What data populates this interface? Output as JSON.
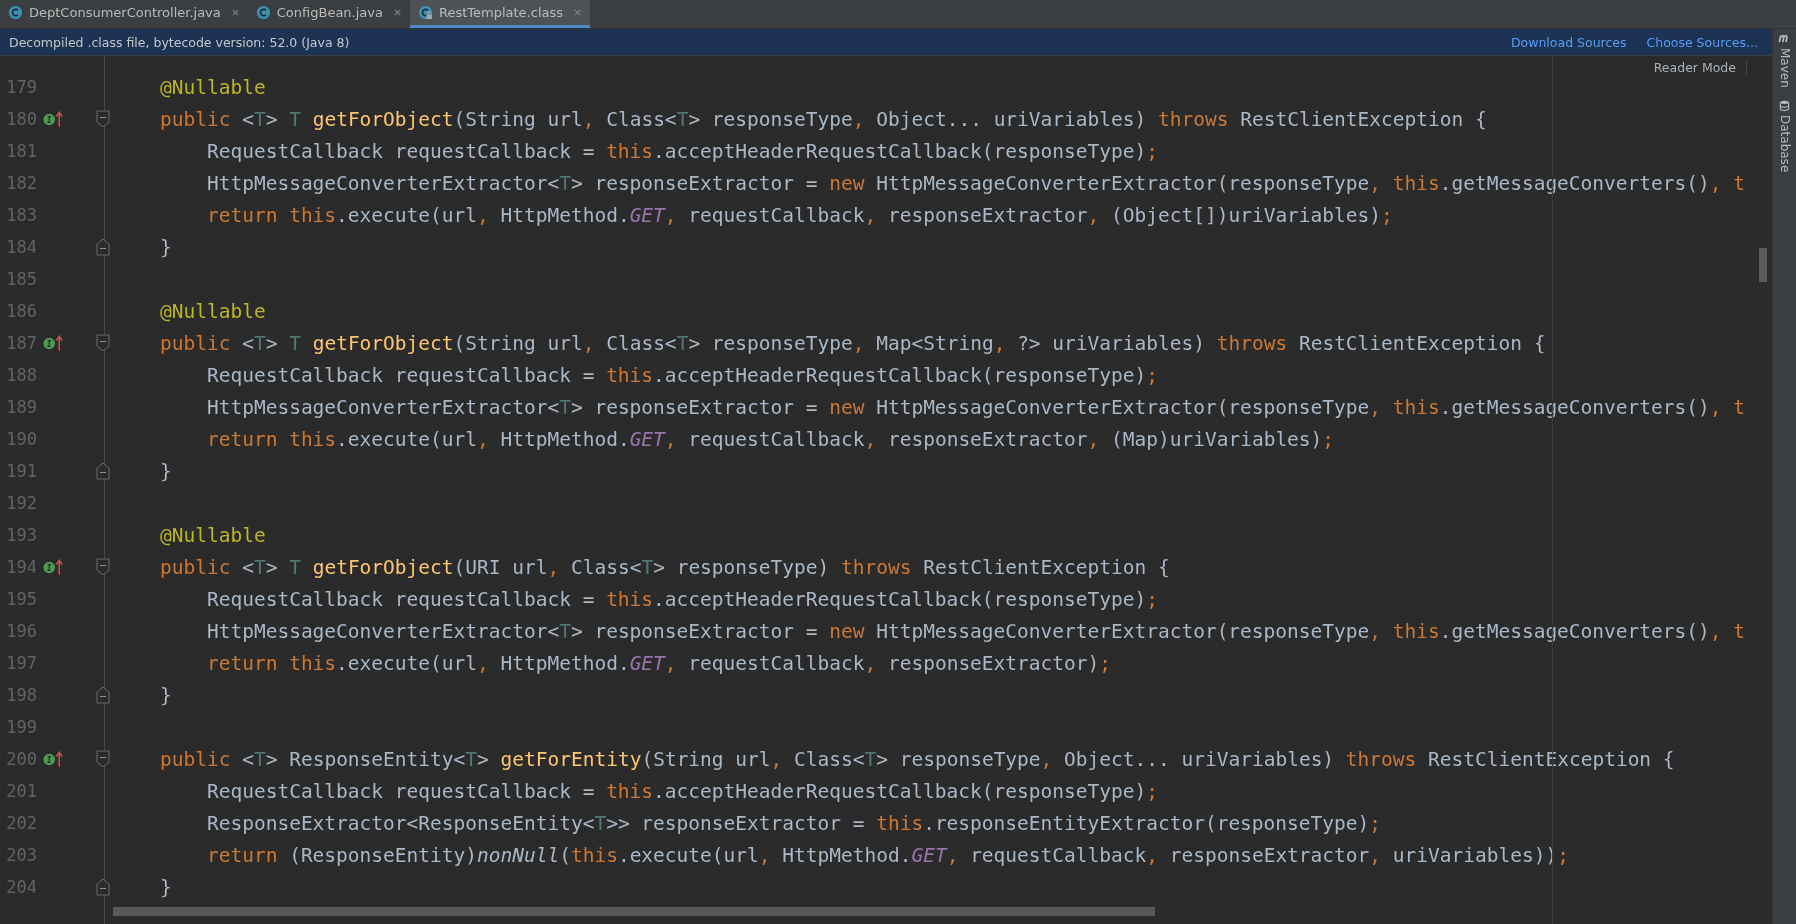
{
  "tabs": [
    {
      "label": "DeptConsumerController.java",
      "selected": false,
      "locked": false
    },
    {
      "label": "ConfigBean.java",
      "selected": false,
      "locked": false
    },
    {
      "label": "RestTemplate.class",
      "selected": true,
      "locked": true
    }
  ],
  "banner": {
    "message": "Decompiled .class file, bytecode version: 52.0 (Java 8)",
    "links": [
      "Download Sources",
      "Choose Sources..."
    ]
  },
  "reader_mode": "Reader Mode",
  "side_tools": [
    {
      "kind": "maven",
      "label": "Maven"
    },
    {
      "kind": "database",
      "label": "Database"
    }
  ],
  "lines": [
    {
      "number": "179",
      "tokens": [
        {
          "kind": "ann",
          "text": "@Nullable"
        }
      ]
    },
    {
      "number": "180",
      "gutter_icon": {
        "kind": "override"
      },
      "fold": {
        "kind": "start"
      },
      "tokens": [
        {
          "kind": "kw",
          "text": "public "
        },
        {
          "kind": "p",
          "text": "<"
        },
        {
          "kind": "tp",
          "text": "T"
        },
        {
          "kind": "p",
          "text": "> "
        },
        {
          "kind": "tp",
          "text": "T "
        },
        {
          "kind": "fn",
          "text": "getForObject"
        },
        {
          "kind": "p",
          "text": "(String url"
        },
        {
          "kind": "kw",
          "text": ", "
        },
        {
          "kind": "p",
          "text": "Class<"
        },
        {
          "kind": "tp",
          "text": "T"
        },
        {
          "kind": "p",
          "text": "> responseType"
        },
        {
          "kind": "kw",
          "text": ", "
        },
        {
          "kind": "p",
          "text": "Object... uriVariables) "
        },
        {
          "kind": "kw",
          "text": "throws "
        },
        {
          "kind": "p",
          "text": "RestClientException {"
        }
      ]
    },
    {
      "number": "181",
      "tokens": [
        {
          "kind": "p",
          "text": "    RequestCallback requestCallback = "
        },
        {
          "kind": "kw",
          "text": "this"
        },
        {
          "kind": "p",
          "text": ".acceptHeaderRequestCallback(responseType)"
        },
        {
          "kind": "kw",
          "text": ";"
        }
      ]
    },
    {
      "number": "182",
      "tokens": [
        {
          "kind": "p",
          "text": "    HttpMessageConverterExtractor<"
        },
        {
          "kind": "tp",
          "text": "T"
        },
        {
          "kind": "p",
          "text": "> responseExtractor = "
        },
        {
          "kind": "kw",
          "text": "new "
        },
        {
          "kind": "p",
          "text": "HttpMessageConverterExtractor(responseType"
        },
        {
          "kind": "kw",
          "text": ", this"
        },
        {
          "kind": "p",
          "text": ".getMessageConverters()"
        },
        {
          "kind": "kw",
          "text": ", t"
        }
      ]
    },
    {
      "number": "183",
      "tokens": [
        {
          "kind": "kw",
          "text": "    return this"
        },
        {
          "kind": "p",
          "text": ".execute(url"
        },
        {
          "kind": "kw",
          "text": ", "
        },
        {
          "kind": "p",
          "text": "HttpMethod."
        },
        {
          "kind": "const",
          "text": "GET"
        },
        {
          "kind": "kw",
          "text": ", "
        },
        {
          "kind": "p",
          "text": "requestCallback"
        },
        {
          "kind": "kw",
          "text": ", "
        },
        {
          "kind": "p",
          "text": "responseExtractor"
        },
        {
          "kind": "kw",
          "text": ", "
        },
        {
          "kind": "p",
          "text": "(Object[])uriVariables)"
        },
        {
          "kind": "kw",
          "text": ";"
        }
      ]
    },
    {
      "number": "184",
      "fold": {
        "kind": "end"
      },
      "tokens": [
        {
          "kind": "p",
          "text": "}"
        }
      ]
    },
    {
      "number": "185"
    },
    {
      "number": "186",
      "tokens": [
        {
          "kind": "ann",
          "text": "@Nullable"
        }
      ]
    },
    {
      "number": "187",
      "gutter_icon": {
        "kind": "override"
      },
      "fold": {
        "kind": "start"
      },
      "tokens": [
        {
          "kind": "kw",
          "text": "public "
        },
        {
          "kind": "p",
          "text": "<"
        },
        {
          "kind": "tp",
          "text": "T"
        },
        {
          "kind": "p",
          "text": "> "
        },
        {
          "kind": "tp",
          "text": "T "
        },
        {
          "kind": "fn",
          "text": "getForObject"
        },
        {
          "kind": "p",
          "text": "(String url"
        },
        {
          "kind": "kw",
          "text": ", "
        },
        {
          "kind": "p",
          "text": "Class<"
        },
        {
          "kind": "tp",
          "text": "T"
        },
        {
          "kind": "p",
          "text": "> responseType"
        },
        {
          "kind": "kw",
          "text": ", "
        },
        {
          "kind": "p",
          "text": "Map<String"
        },
        {
          "kind": "kw",
          "text": ", "
        },
        {
          "kind": "p",
          "text": "?> uriVariables) "
        },
        {
          "kind": "kw",
          "text": "throws "
        },
        {
          "kind": "p",
          "text": "RestClientException {"
        }
      ]
    },
    {
      "number": "188",
      "tokens": [
        {
          "kind": "p",
          "text": "    RequestCallback requestCallback = "
        },
        {
          "kind": "kw",
          "text": "this"
        },
        {
          "kind": "p",
          "text": ".acceptHeaderRequestCallback(responseType)"
        },
        {
          "kind": "kw",
          "text": ";"
        }
      ]
    },
    {
      "number": "189",
      "tokens": [
        {
          "kind": "p",
          "text": "    HttpMessageConverterExtractor<"
        },
        {
          "kind": "tp",
          "text": "T"
        },
        {
          "kind": "p",
          "text": "> responseExtractor = "
        },
        {
          "kind": "kw",
          "text": "new "
        },
        {
          "kind": "p",
          "text": "HttpMessageConverterExtractor(responseType"
        },
        {
          "kind": "kw",
          "text": ", this"
        },
        {
          "kind": "p",
          "text": ".getMessageConverters()"
        },
        {
          "kind": "kw",
          "text": ", t"
        }
      ]
    },
    {
      "number": "190",
      "tokens": [
        {
          "kind": "kw",
          "text": "    return this"
        },
        {
          "kind": "p",
          "text": ".execute(url"
        },
        {
          "kind": "kw",
          "text": ", "
        },
        {
          "kind": "p",
          "text": "HttpMethod."
        },
        {
          "kind": "const",
          "text": "GET"
        },
        {
          "kind": "kw",
          "text": ", "
        },
        {
          "kind": "p",
          "text": "requestCallback"
        },
        {
          "kind": "kw",
          "text": ", "
        },
        {
          "kind": "p",
          "text": "responseExtractor"
        },
        {
          "kind": "kw",
          "text": ", "
        },
        {
          "kind": "p",
          "text": "(Map)uriVariables)"
        },
        {
          "kind": "kw",
          "text": ";"
        }
      ]
    },
    {
      "number": "191",
      "fold": {
        "kind": "end"
      },
      "tokens": [
        {
          "kind": "p",
          "text": "}"
        }
      ]
    },
    {
      "number": "192"
    },
    {
      "number": "193",
      "tokens": [
        {
          "kind": "ann",
          "text": "@Nullable"
        }
      ]
    },
    {
      "number": "194",
      "gutter_icon": {
        "kind": "override"
      },
      "fold": {
        "kind": "start"
      },
      "tokens": [
        {
          "kind": "kw",
          "text": "public "
        },
        {
          "kind": "p",
          "text": "<"
        },
        {
          "kind": "tp",
          "text": "T"
        },
        {
          "kind": "p",
          "text": "> "
        },
        {
          "kind": "tp",
          "text": "T "
        },
        {
          "kind": "fn",
          "text": "getForObject"
        },
        {
          "kind": "p",
          "text": "(URI url"
        },
        {
          "kind": "kw",
          "text": ", "
        },
        {
          "kind": "p",
          "text": "Class<"
        },
        {
          "kind": "tp",
          "text": "T"
        },
        {
          "kind": "p",
          "text": "> responseType) "
        },
        {
          "kind": "kw",
          "text": "throws "
        },
        {
          "kind": "p",
          "text": "RestClientException {"
        }
      ]
    },
    {
      "number": "195",
      "tokens": [
        {
          "kind": "p",
          "text": "    RequestCallback requestCallback = "
        },
        {
          "kind": "kw",
          "text": "this"
        },
        {
          "kind": "p",
          "text": ".acceptHeaderRequestCallback(responseType)"
        },
        {
          "kind": "kw",
          "text": ";"
        }
      ]
    },
    {
      "number": "196",
      "tokens": [
        {
          "kind": "p",
          "text": "    HttpMessageConverterExtractor<"
        },
        {
          "kind": "tp",
          "text": "T"
        },
        {
          "kind": "p",
          "text": "> responseExtractor = "
        },
        {
          "kind": "kw",
          "text": "new "
        },
        {
          "kind": "p",
          "text": "HttpMessageConverterExtractor(responseType"
        },
        {
          "kind": "kw",
          "text": ", this"
        },
        {
          "kind": "p",
          "text": ".getMessageConverters()"
        },
        {
          "kind": "kw",
          "text": ", t"
        }
      ]
    },
    {
      "number": "197",
      "tokens": [
        {
          "kind": "kw",
          "text": "    return this"
        },
        {
          "kind": "p",
          "text": ".execute(url"
        },
        {
          "kind": "kw",
          "text": ", "
        },
        {
          "kind": "p",
          "text": "HttpMethod."
        },
        {
          "kind": "const",
          "text": "GET"
        },
        {
          "kind": "kw",
          "text": ", "
        },
        {
          "kind": "p",
          "text": "requestCallback"
        },
        {
          "kind": "kw",
          "text": ", "
        },
        {
          "kind": "p",
          "text": "responseExtractor)"
        },
        {
          "kind": "kw",
          "text": ";"
        }
      ]
    },
    {
      "number": "198",
      "fold": {
        "kind": "end"
      },
      "tokens": [
        {
          "kind": "p",
          "text": "}"
        }
      ]
    },
    {
      "number": "199"
    },
    {
      "number": "200",
      "gutter_icon": {
        "kind": "override"
      },
      "fold": {
        "kind": "start"
      },
      "tokens": [
        {
          "kind": "kw",
          "text": "public "
        },
        {
          "kind": "p",
          "text": "<"
        },
        {
          "kind": "tp",
          "text": "T"
        },
        {
          "kind": "p",
          "text": "> ResponseEntity<"
        },
        {
          "kind": "tp",
          "text": "T"
        },
        {
          "kind": "p",
          "text": "> "
        },
        {
          "kind": "fn",
          "text": "getForEntity"
        },
        {
          "kind": "p",
          "text": "(String url"
        },
        {
          "kind": "kw",
          "text": ", "
        },
        {
          "kind": "p",
          "text": "Class<"
        },
        {
          "kind": "tp",
          "text": "T"
        },
        {
          "kind": "p",
          "text": "> responseType"
        },
        {
          "kind": "kw",
          "text": ", "
        },
        {
          "kind": "p",
          "text": "Object... uriVariables) "
        },
        {
          "kind": "kw",
          "text": "throws "
        },
        {
          "kind": "p",
          "text": "RestClientException {"
        }
      ]
    },
    {
      "number": "201",
      "tokens": [
        {
          "kind": "p",
          "text": "    RequestCallback requestCallback = "
        },
        {
          "kind": "kw",
          "text": "this"
        },
        {
          "kind": "p",
          "text": ".acceptHeaderRequestCallback(responseType)"
        },
        {
          "kind": "kw",
          "text": ";"
        }
      ]
    },
    {
      "number": "202",
      "tokens": [
        {
          "kind": "p",
          "text": "    ResponseExtractor<ResponseEntity<"
        },
        {
          "kind": "tp",
          "text": "T"
        },
        {
          "kind": "p",
          "text": ">> responseExtractor = "
        },
        {
          "kind": "kw",
          "text": "this"
        },
        {
          "kind": "p",
          "text": ".responseEntityExtractor(responseType)"
        },
        {
          "kind": "kw",
          "text": ";"
        }
      ]
    },
    {
      "number": "203",
      "tokens": [
        {
          "kind": "kw",
          "text": "    return "
        },
        {
          "kind": "p",
          "text": "(ResponseEntity)"
        },
        {
          "kind": "call",
          "text": "nonNull"
        },
        {
          "kind": "p",
          "text": "("
        },
        {
          "kind": "kw",
          "text": "this"
        },
        {
          "kind": "p",
          "text": ".execute(url"
        },
        {
          "kind": "kw",
          "text": ", "
        },
        {
          "kind": "p",
          "text": "HttpMethod."
        },
        {
          "kind": "const",
          "text": "GET"
        },
        {
          "kind": "kw",
          "text": ", "
        },
        {
          "kind": "p",
          "text": "requestCallback"
        },
        {
          "kind": "kw",
          "text": ", "
        },
        {
          "kind": "p",
          "text": "responseExtractor"
        },
        {
          "kind": "kw",
          "text": ", "
        },
        {
          "kind": "p",
          "text": "uriVariables))"
        },
        {
          "kind": "kw",
          "text": ";"
        }
      ]
    },
    {
      "number": "204",
      "fold": {
        "kind": "end"
      },
      "tokens": [
        {
          "kind": "p",
          "text": "}"
        }
      ]
    }
  ]
}
